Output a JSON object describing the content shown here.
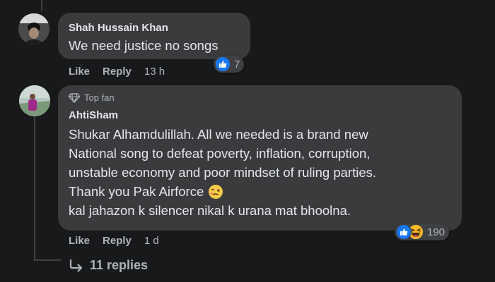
{
  "comments": [
    {
      "author": "Shah Hussain Khan",
      "text_lines": [
        "We need justice no songs"
      ],
      "like_label": "Like",
      "reply_label": "Reply",
      "time": "13 h",
      "reaction_count": "7",
      "reactions": [
        "like-icon"
      ]
    },
    {
      "badge": "Top fan",
      "author": "AhtiSham",
      "text_lines": [
        "Shukar Alhamdulillah. All we needed is a brand new",
        "National song to defeat poverty, inflation, corruption,",
        "unstable economy and poor mindset of ruling parties.",
        "Thank you Pak Airforce",
        "kal jahazon k silencer nikal k urana mat bhoolna."
      ],
      "like_label": "Like",
      "reply_label": "Reply",
      "time": "1 d",
      "reaction_count": "190",
      "reactions": [
        "like-icon",
        "haha-icon"
      ]
    }
  ],
  "replies": {
    "label": "11 replies"
  },
  "colors": {
    "background": "#18191a",
    "bubble": "#3a3b3c",
    "text": "#e4e6eb",
    "muted": "#b0b3b8",
    "like_blue": "#1877f2",
    "haha_yellow": "#f7b928"
  }
}
